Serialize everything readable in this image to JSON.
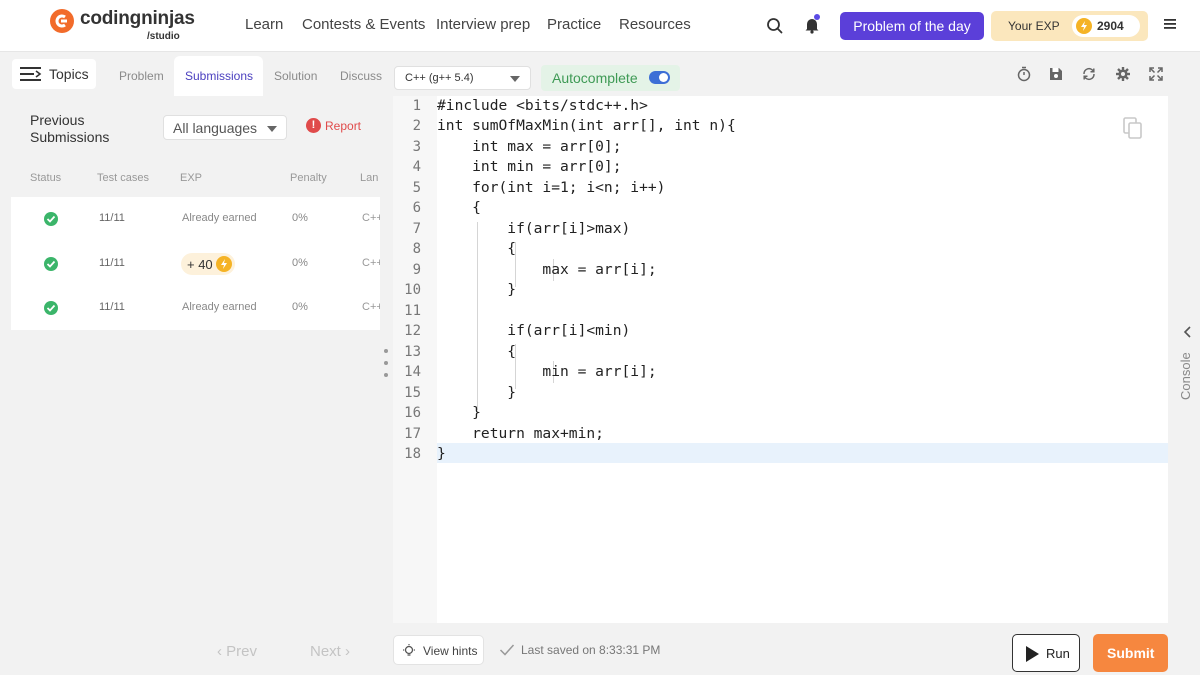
{
  "brand": {
    "name": "codingninjas",
    "sub": "/studio"
  },
  "nav": [
    "Learn",
    "Contests & Events",
    "Interview prep",
    "Practice",
    "Resources"
  ],
  "header": {
    "potd_label": "Problem of the day",
    "exp_label": "Your EXP",
    "exp_value": "2904"
  },
  "left": {
    "topics_label": "Topics",
    "tabs": [
      "Problem",
      "Submissions",
      "Solution",
      "Discuss"
    ],
    "active_tab": "Submissions",
    "prev_title_1": "Previous",
    "prev_title_2": "Submissions",
    "language_filter": "All languages",
    "report_label": "Report",
    "columns": [
      "Status",
      "Test cases",
      "EXP",
      "Penalty",
      "Lan"
    ],
    "rows": [
      {
        "status": "accepted",
        "tests": "11/11",
        "exp": "Already earned",
        "penalty": "0%",
        "lang": "C++"
      },
      {
        "status": "accepted",
        "tests": "11/11",
        "exp": "+ 40",
        "penalty": "0%",
        "lang": "C++"
      },
      {
        "status": "accepted",
        "tests": "11/11",
        "exp": "Already earned",
        "penalty": "0%",
        "lang": "C++"
      }
    ],
    "prev_label": "Prev",
    "next_label": "Next"
  },
  "toolbar": {
    "compiler": "C++ (g++ 5.4)",
    "autocomplete_label": "Autocomplete",
    "autocomplete_on": true,
    "icons": [
      "timer-icon",
      "save-icon",
      "reset-icon",
      "settings-icon",
      "fullscreen-icon"
    ]
  },
  "editor": {
    "lines": [
      "#include <bits/stdc++.h>",
      "int sumOfMaxMin(int arr[], int n){",
      "    int max = arr[0];",
      "    int min = arr[0];",
      "    for(int i=1; i<n; i++)",
      "    {",
      "        if(arr[i]>max)",
      "        {",
      "            max = arr[i];",
      "        }",
      "",
      "        if(arr[i]<min)",
      "        {",
      "            min = arr[i];",
      "        }",
      "    }",
      "    return max+min;",
      "}"
    ],
    "active_line": 18
  },
  "console_label": "Console",
  "footer": {
    "hints_label": "View hints",
    "saved_text": "Last saved on 8:33:31 PM",
    "run_label": "Run",
    "submit_label": "Submit"
  },
  "colors": {
    "brand_orange": "#f26b2a",
    "potd_purple": "#5b3fd9",
    "submit_orange": "#f6873f",
    "success_green": "#3bb56a",
    "keyword": "#770088",
    "number": "#116644"
  }
}
